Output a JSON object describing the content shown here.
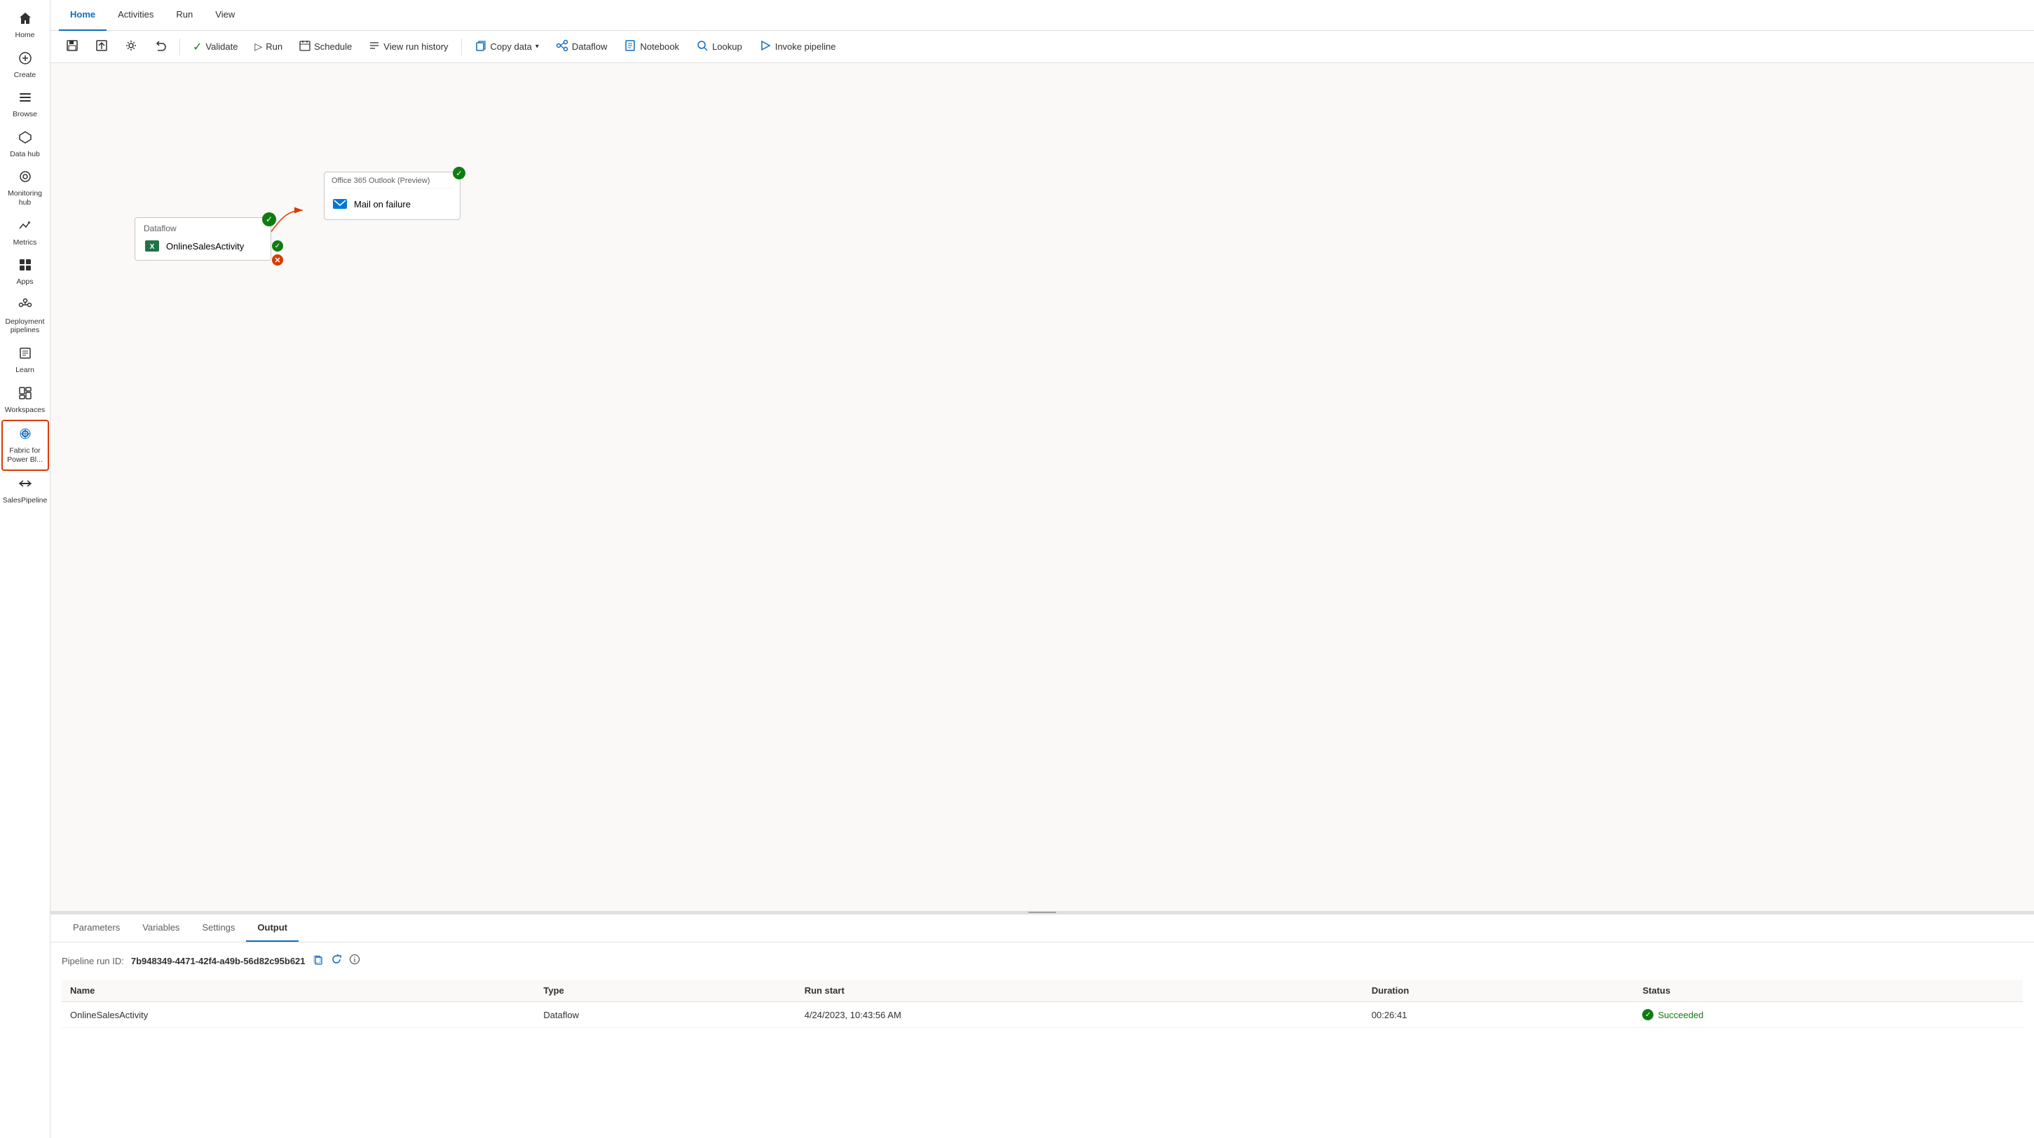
{
  "sidebar": {
    "items": [
      {
        "id": "home",
        "label": "Home",
        "icon": "⌂"
      },
      {
        "id": "create",
        "label": "Create",
        "icon": "+"
      },
      {
        "id": "browse",
        "label": "Browse",
        "icon": "☰"
      },
      {
        "id": "data-hub",
        "label": "Data hub",
        "icon": "⬡"
      },
      {
        "id": "monitoring-hub",
        "label": "Monitoring hub",
        "icon": "◎"
      },
      {
        "id": "metrics",
        "label": "Metrics",
        "icon": "↗"
      },
      {
        "id": "apps",
        "label": "Apps",
        "icon": "⊞"
      },
      {
        "id": "deployment-pipelines",
        "label": "Deployment pipelines",
        "icon": "⎇"
      },
      {
        "id": "learn",
        "label": "Learn",
        "icon": "📖"
      },
      {
        "id": "workspaces",
        "label": "Workspaces",
        "icon": "🗂"
      },
      {
        "id": "fabric-power-bi",
        "label": "Fabric for Power Bl...",
        "icon": "⚙"
      },
      {
        "id": "sales-pipeline",
        "label": "SalesPipeline",
        "icon": "⟷"
      }
    ]
  },
  "top_nav": {
    "tabs": [
      {
        "id": "home",
        "label": "Home",
        "active": true
      },
      {
        "id": "activities",
        "label": "Activities"
      },
      {
        "id": "run",
        "label": "Run"
      },
      {
        "id": "view",
        "label": "View"
      }
    ]
  },
  "toolbar": {
    "buttons": [
      {
        "id": "save",
        "icon": "💾",
        "label": "",
        "show_label": false
      },
      {
        "id": "save-draft",
        "icon": "📋",
        "label": "",
        "show_label": false
      },
      {
        "id": "settings",
        "icon": "⚙",
        "label": "",
        "show_label": false
      },
      {
        "id": "undo",
        "icon": "↩",
        "label": "",
        "show_label": false
      },
      {
        "id": "validate",
        "icon": "✓",
        "label": "Validate",
        "show_label": true
      },
      {
        "id": "run",
        "icon": "▷",
        "label": "Run",
        "show_label": true
      },
      {
        "id": "schedule",
        "icon": "📅",
        "label": "Schedule",
        "show_label": true
      },
      {
        "id": "view-run-history",
        "icon": "≡",
        "label": "View run history",
        "show_label": true
      },
      {
        "id": "copy-data",
        "icon": "📋",
        "label": "Copy data",
        "show_label": true,
        "has_dropdown": true
      },
      {
        "id": "dataflow",
        "icon": "🔀",
        "label": "Dataflow",
        "show_label": true
      },
      {
        "id": "notebook",
        "icon": "📓",
        "label": "Notebook",
        "show_label": true
      },
      {
        "id": "lookup",
        "icon": "🔍",
        "label": "Lookup",
        "show_label": true
      },
      {
        "id": "invoke-pipeline",
        "icon": "⚡",
        "label": "Invoke pipeline",
        "show_label": true
      }
    ]
  },
  "canvas": {
    "dataflow_node": {
      "header": "Dataflow",
      "activity_name": "OnlineSalesActivity",
      "has_success": true
    },
    "o365_node": {
      "header": "Office 365 Outlook (Preview)",
      "activity_name": "Mail on failure",
      "has_success": true
    }
  },
  "bottom_panel": {
    "tabs": [
      {
        "id": "parameters",
        "label": "Parameters"
      },
      {
        "id": "variables",
        "label": "Variables"
      },
      {
        "id": "settings",
        "label": "Settings"
      },
      {
        "id": "output",
        "label": "Output",
        "active": true
      }
    ],
    "pipeline_run_id": {
      "label": "Pipeline run ID:",
      "value": "7b948349-4471-42f4-a49b-56d82c95b621"
    },
    "output_table": {
      "columns": [
        "Name",
        "Type",
        "Run start",
        "Duration",
        "Status"
      ],
      "rows": [
        {
          "name": "OnlineSalesActivity",
          "type": "Dataflow",
          "run_start": "4/24/2023, 10:43:56 AM",
          "duration": "00:26:41",
          "status": "Succeeded"
        }
      ]
    }
  }
}
